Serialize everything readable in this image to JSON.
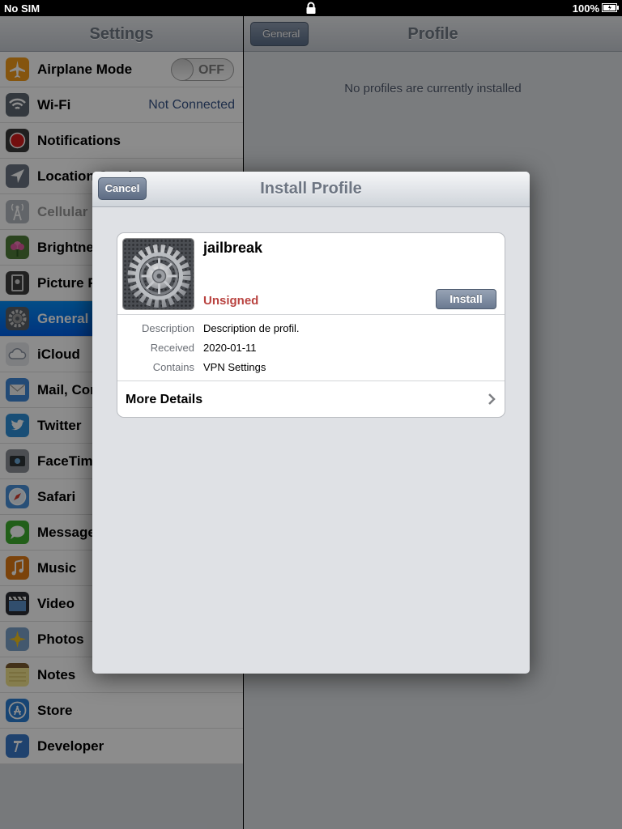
{
  "status_bar": {
    "carrier": "No SIM",
    "battery": "100%"
  },
  "master": {
    "title": "Settings",
    "rows": [
      {
        "label": "Airplane Mode",
        "toggle": "OFF",
        "icon": "airplane-icon"
      },
      {
        "label": "Wi-Fi",
        "value": "Not Connected",
        "icon": "wifi-icon"
      },
      {
        "label": "Notifications",
        "icon": "notifications-icon"
      },
      {
        "label": "Location Services",
        "icon": "location-icon"
      },
      {
        "label": "Cellular Data",
        "icon": "cellular-icon"
      },
      {
        "label": "Brightness & Wallpaper",
        "icon": "brightness-icon"
      },
      {
        "label": "Picture Frame",
        "icon": "picture-frame-icon"
      },
      {
        "label": "General",
        "icon": "gear-icon"
      },
      {
        "label": "iCloud",
        "icon": "icloud-icon"
      },
      {
        "label": "Mail, Contacts, Calendars",
        "icon": "mail-icon"
      },
      {
        "label": "Twitter",
        "icon": "twitter-icon"
      },
      {
        "label": "FaceTime",
        "icon": "facetime-icon"
      },
      {
        "label": "Safari",
        "icon": "safari-icon"
      },
      {
        "label": "Messages",
        "icon": "messages-icon"
      },
      {
        "label": "Music",
        "icon": "music-icon"
      },
      {
        "label": "Video",
        "icon": "video-icon"
      },
      {
        "label": "Photos",
        "icon": "photos-icon"
      },
      {
        "label": "Notes",
        "icon": "notes-icon"
      },
      {
        "label": "Store",
        "icon": "store-icon"
      },
      {
        "label": "Developer",
        "icon": "developer-icon"
      }
    ]
  },
  "detail": {
    "back_label": "General",
    "title": "Profile",
    "empty_message": "No profiles are currently installed"
  },
  "modal": {
    "title": "Install Profile",
    "cancel_label": "Cancel",
    "profile": {
      "name": "jailbreak",
      "signed_status": "Unsigned",
      "install_label": "Install",
      "description_key": "Description",
      "description": "Description de profil.",
      "received_key": "Received",
      "received": "2020-01-11",
      "contains_key": "Contains",
      "contains": "VPN Settings"
    },
    "more_details_label": "More Details"
  },
  "colors": {
    "accent": "#015fe6",
    "unsigned": "#b94340"
  }
}
